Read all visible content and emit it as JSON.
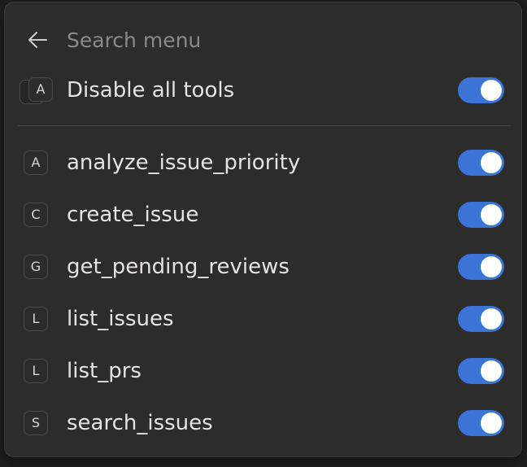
{
  "search": {
    "placeholder": "Search menu",
    "value": ""
  },
  "master": {
    "badge_letter": "A",
    "label": "Disable all tools",
    "enabled": true
  },
  "tools": [
    {
      "letter": "A",
      "name": "analyze_issue_priority",
      "enabled": true
    },
    {
      "letter": "C",
      "name": "create_issue",
      "enabled": true
    },
    {
      "letter": "G",
      "name": "get_pending_reviews",
      "enabled": true
    },
    {
      "letter": "L",
      "name": "list_issues",
      "enabled": true
    },
    {
      "letter": "L",
      "name": "list_prs",
      "enabled": true
    },
    {
      "letter": "S",
      "name": "search_issues",
      "enabled": true
    }
  ],
  "colors": {
    "toggle_on": "#3b74d6",
    "menu_bg": "#2c2c2b"
  },
  "icons": {
    "back": "arrow-left-icon"
  }
}
